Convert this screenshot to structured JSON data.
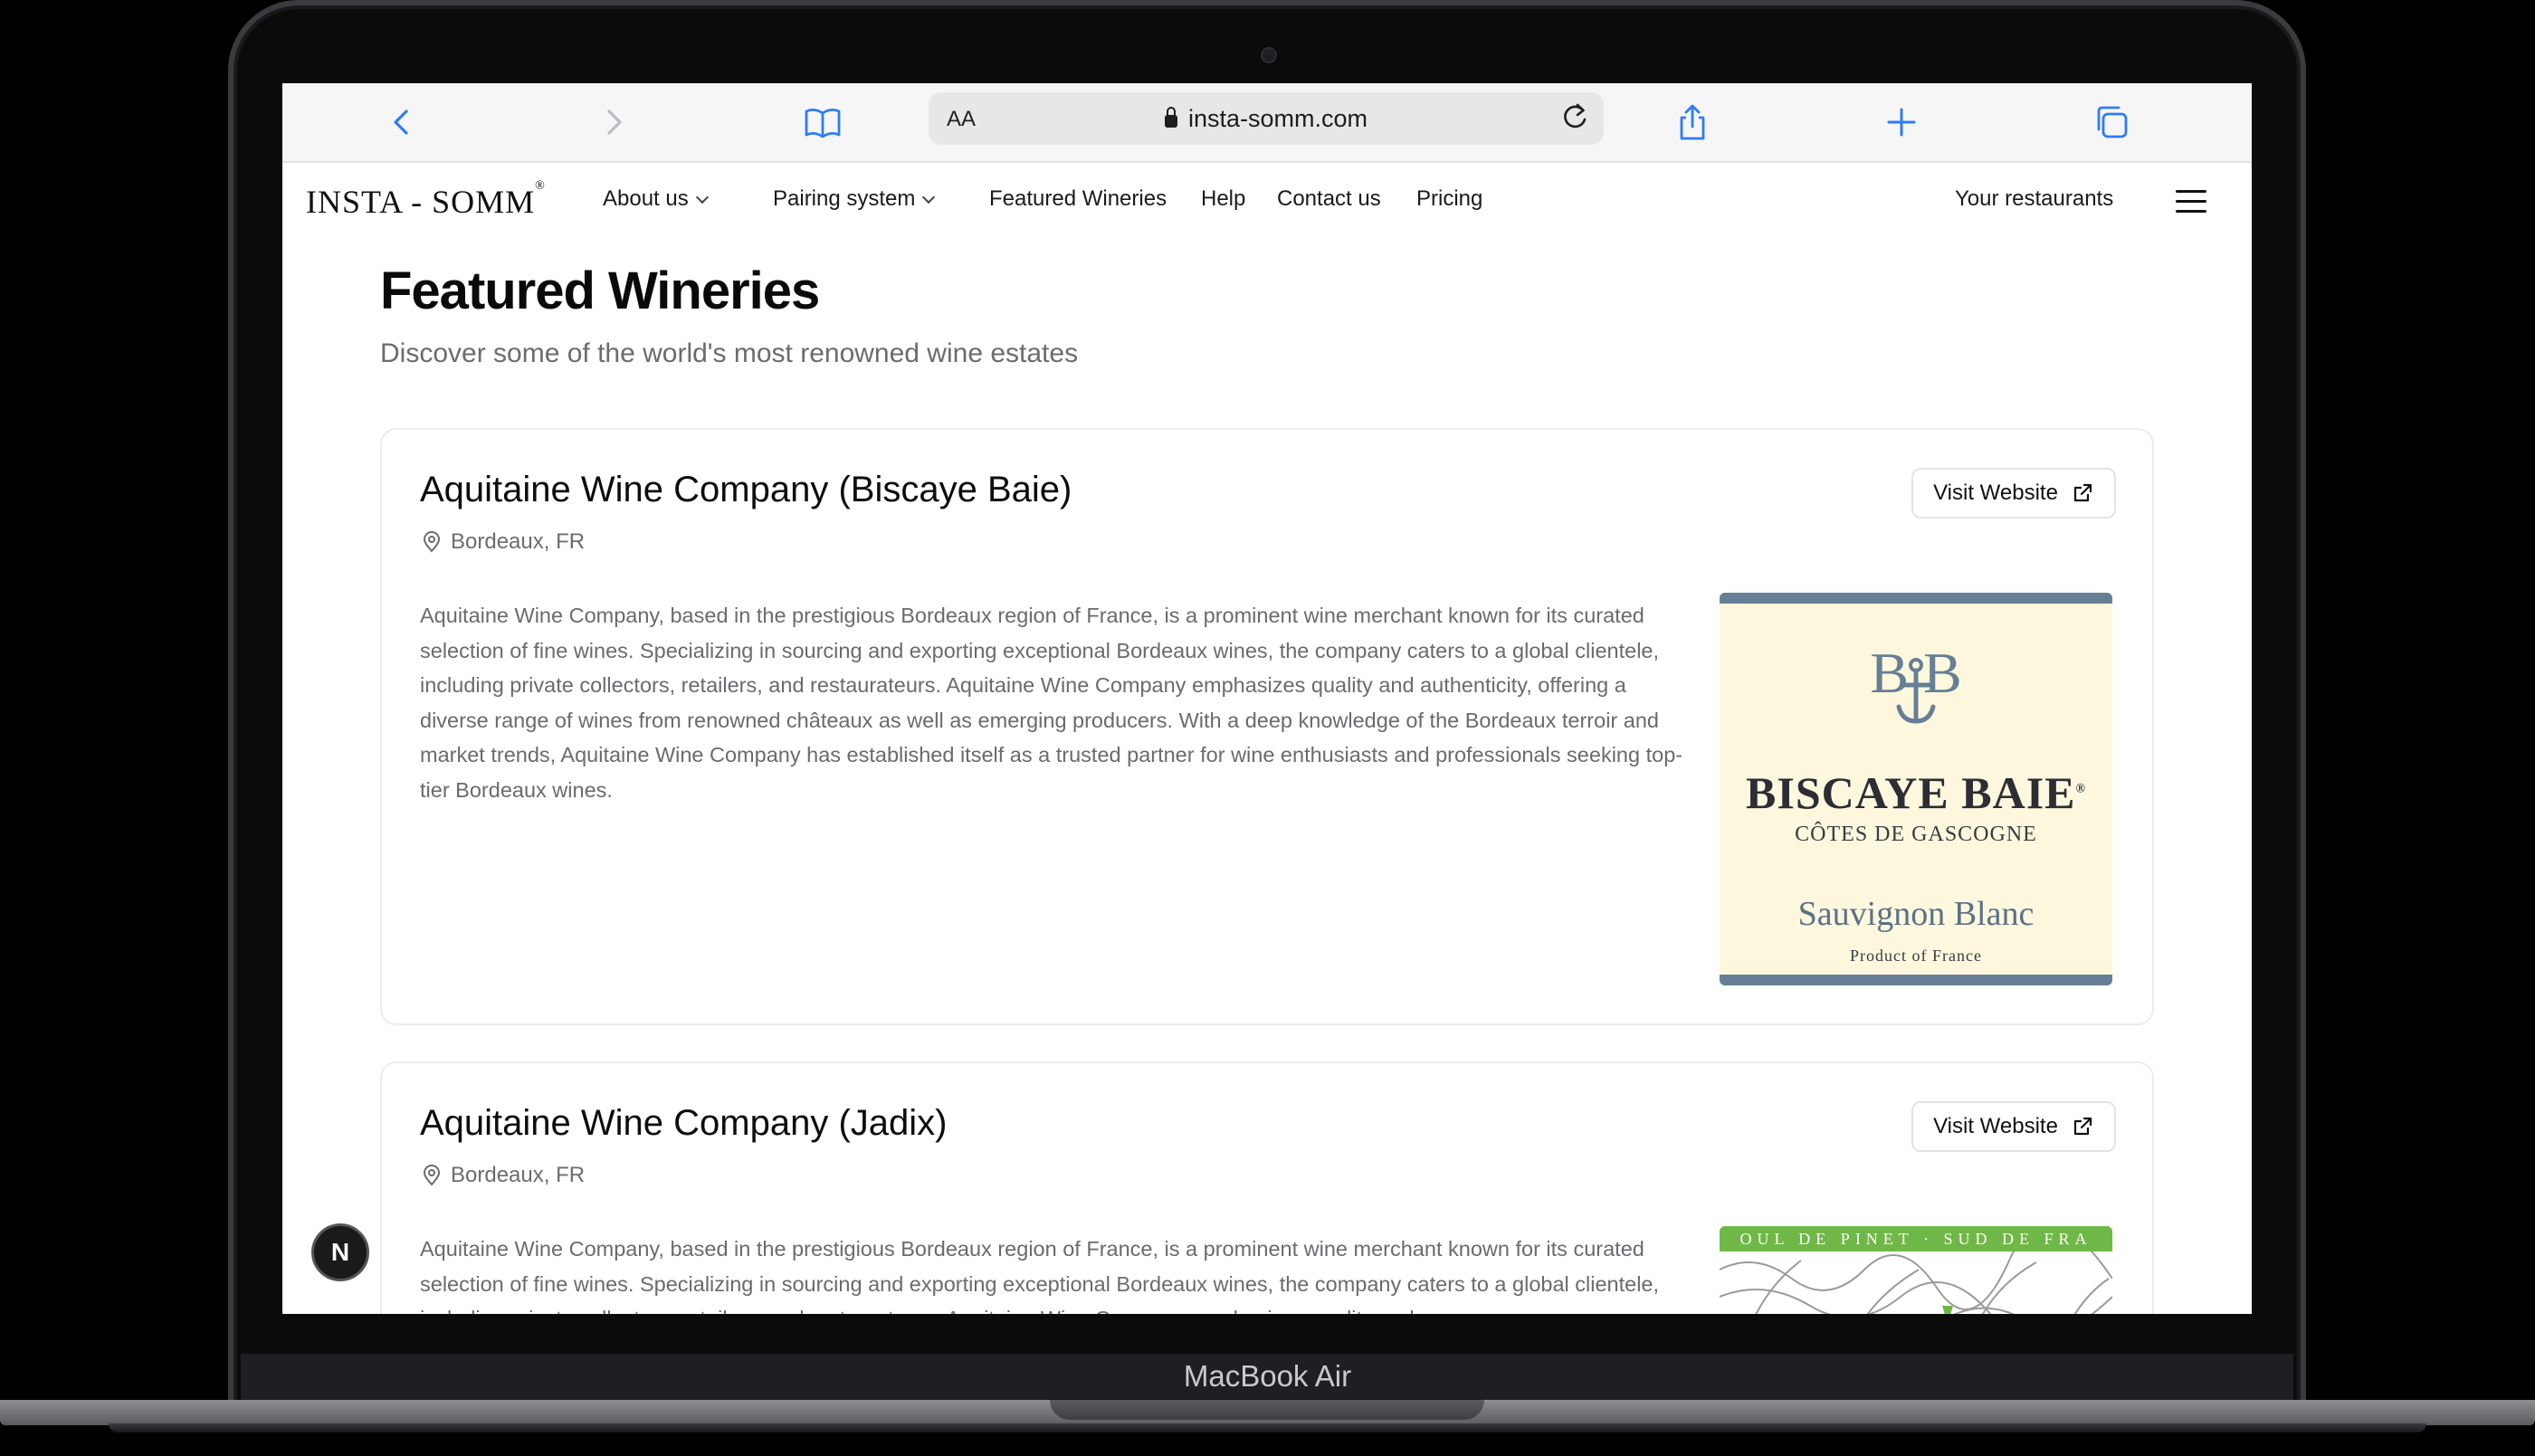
{
  "device": {
    "label": "MacBook Air"
  },
  "browser": {
    "url": "insta-somm.com",
    "reader_label": "AA",
    "icons": [
      "back-icon",
      "forward-icon",
      "bookmarks-icon",
      "lock-icon",
      "reload-icon",
      "share-icon",
      "new-tab-icon",
      "tabs-icon"
    ]
  },
  "site": {
    "logo": "INSTA - SOMM",
    "logo_mark": "®",
    "nav": {
      "about": "About us",
      "pairing": "Pairing system",
      "featured": "Featured Wineries",
      "help": "Help",
      "contact": "Contact us",
      "pricing": "Pricing",
      "restaurants": "Your restaurants"
    }
  },
  "page": {
    "title": "Featured Wineries",
    "subtitle": "Discover some of the world's most renowned wine estates"
  },
  "wineries": [
    {
      "name": "Aquitaine Wine Company (Biscaye Baie)",
      "location": "Bordeaux, FR",
      "button": "Visit Website",
      "description": "Aquitaine Wine Company, based in the prestigious Bordeaux region of France, is a prominent wine merchant known for its curated selection of fine wines. Specializing in sourcing and exporting exceptional Bordeaux wines, the company caters to a global clientele, including private collectors, retailers, and restaurateurs. Aquitaine Wine Company emphasizes quality and authenticity, offering a diverse range of wines from renowned châteaux as well as emerging producers. With a deep knowledge of the Bordeaux terroir and market trends, Aquitaine Wine Company has established itself as a trusted partner for wine enthusiasts and professionals seeking top-tier Bordeaux wines.",
      "label": {
        "brand": "BISCAYE BAIE",
        "brand_mark": "®",
        "region": "CÔTES DE GASCOGNE",
        "variety": "Sauvignon Blanc",
        "origin": "Product of France"
      }
    },
    {
      "name": "Aquitaine Wine Company (Jadix)",
      "location": "Bordeaux, FR",
      "button": "Visit Website",
      "description": "Aquitaine Wine Company, based in the prestigious Bordeaux region of France, is a prominent wine merchant known for its curated selection of fine wines. Specializing in sourcing and exporting exceptional Bordeaux wines, the company caters to a global clientele, including private collectors, retailers, and restaurateurs. Aquitaine Wine Company emphasizes quality and",
      "label": {
        "band": "OUL DE PINET · SUD DE FRA"
      }
    }
  ],
  "dev_badge": "N",
  "colors": {
    "label_blue": "#667f96",
    "label_cream": "#fdf8dd",
    "label_green": "#6fb847",
    "safari_blue": "#2f7cf6"
  }
}
